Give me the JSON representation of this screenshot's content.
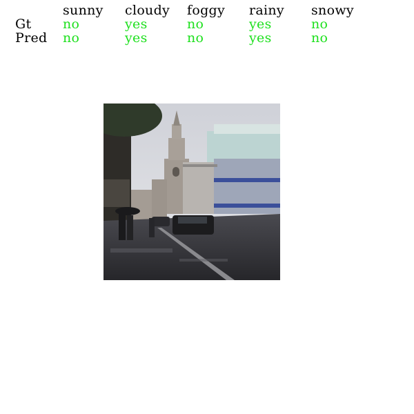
{
  "header": {
    "columns": [
      "sunny",
      "cloudy",
      "foggy",
      "rainy",
      "snowy"
    ]
  },
  "rows": [
    {
      "label": "Gt",
      "values": [
        "no",
        "yes",
        "no",
        "yes",
        "no"
      ]
    },
    {
      "label": "Pred",
      "values": [
        "no",
        "yes",
        "no",
        "yes",
        "no"
      ]
    }
  ],
  "colors": {
    "header_text": "#000000",
    "value_text": "#1ee01e",
    "background": "#ffffff"
  }
}
